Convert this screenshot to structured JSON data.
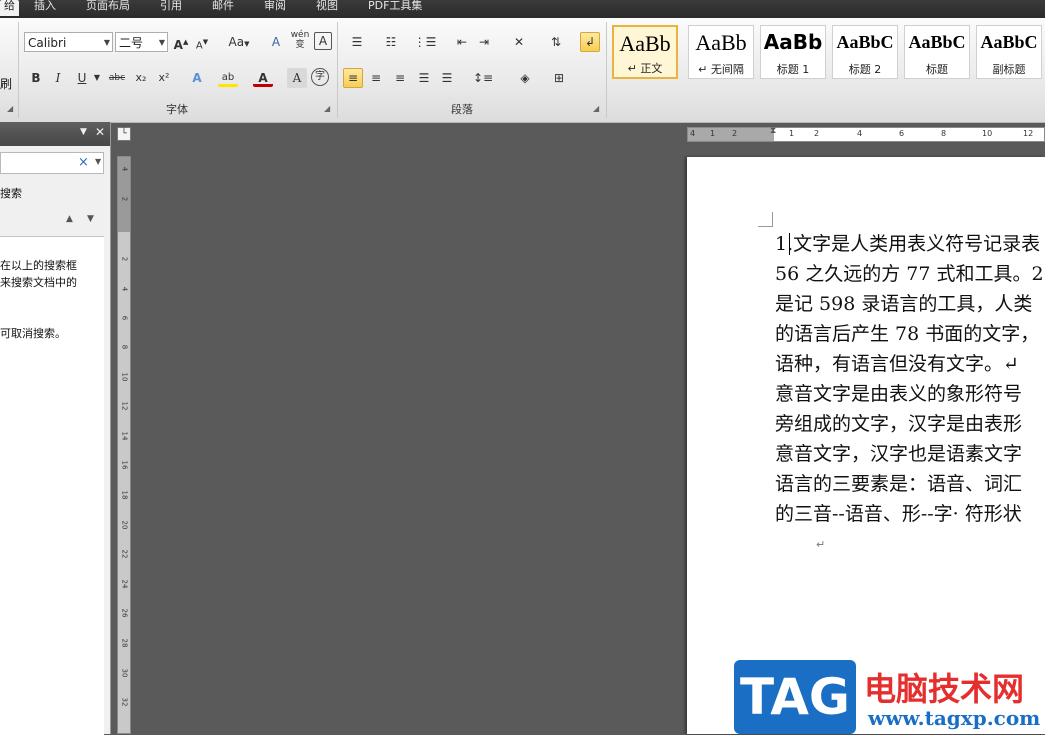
{
  "tabs": [
    "给",
    "插入",
    "页面布局",
    "引用",
    "邮件",
    "审阅",
    "视图",
    "PDF工具集"
  ],
  "font": {
    "name": "Calibri",
    "size": "二号",
    "group_label": "字体",
    "buttons": [
      "B",
      "I",
      "U",
      "abc",
      "x₂",
      "x²",
      "A",
      "ab",
      "A",
      "A",
      "字"
    ],
    "grow": "A",
    "shrink": "A",
    "case": "Aa",
    "clear": "A",
    "pinyin": "wén",
    "border": "A"
  },
  "paragraph": {
    "group_label": "段落"
  },
  "left_edge": {
    "brush_char": "刷"
  },
  "styles": [
    {
      "sample": "AaBb",
      "name": "↵ 正文",
      "selected": true
    },
    {
      "sample": "AaBb",
      "name": "↵ 无间隔",
      "selected": false
    },
    {
      "sample": "AaBb",
      "name": "标题 1",
      "selected": false
    },
    {
      "sample": "AaBbC",
      "name": "标题 2",
      "selected": false
    },
    {
      "sample": "AaBbC",
      "name": "标题",
      "selected": false
    },
    {
      "sample": "AaBbC",
      "name": "副标题",
      "selected": false
    }
  ],
  "nav": {
    "close_x": "×",
    "search_label": "搜索",
    "hint_line1": "在以上的搜索框",
    "hint_line2": "来搜索文档中的",
    "hint_line3": "可取消搜索。"
  },
  "hruler_ticks": [
    "4",
    "1",
    "2",
    "1",
    "2",
    "4",
    "6",
    "8",
    "10",
    "12"
  ],
  "vruler_ticks": [
    "4",
    "2",
    "2",
    "4",
    "6",
    "8",
    "10",
    "12",
    "14",
    "16",
    "18",
    "20",
    "22",
    "24",
    "26",
    "28",
    "30",
    "32"
  ],
  "document": {
    "lines": [
      "1.文字是人类用表义符号记录表",
      "56 之久远的方 77 式和工具。2",
      "是记 598 录语言的工具，人类",
      "的语言后产生 78 书面的文字，",
      "语种，有语言但没有文字。↵",
      "意音文字是由表义的象形符号",
      "旁组成的文字，汉字是由表形",
      "意音文字，汉字也是语素文字",
      "语言的三要素是：语音、词汇",
      "的三音--语音、形--字· 符形状"
    ],
    "empty_para_mark": "↵"
  },
  "watermark": {
    "logo": "TAG",
    "title": "电脑技术网",
    "url": "www.tagxp.com"
  },
  "colors": {
    "accent_highlight": "#f8cd53",
    "watermark_blue": "#1a6fc4",
    "watermark_red": "#e52e2e"
  }
}
